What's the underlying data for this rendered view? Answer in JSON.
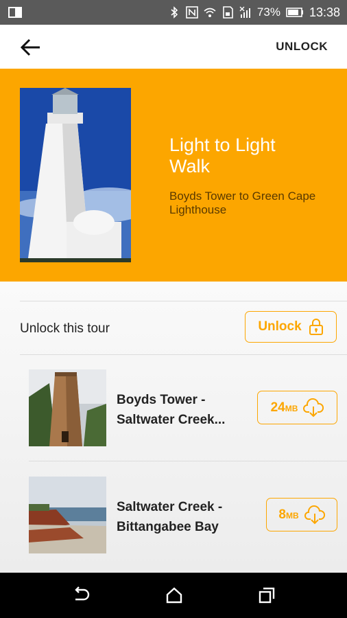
{
  "status_bar": {
    "battery": "73%",
    "time": "13:38"
  },
  "app_bar": {
    "unlock_label": "UNLOCK"
  },
  "hero": {
    "title": "Light to Light Walk",
    "subtitle": "Boyds Tower to Green Cape Lighthouse"
  },
  "unlock_row": {
    "label": "Unlock this tour",
    "button_label": "Unlock"
  },
  "tour_items": [
    {
      "title_line1": "Boyds Tower -",
      "title_line2": "Saltwater Creek...",
      "size": "24",
      "unit": "MB"
    },
    {
      "title_line1": "Saltwater Creek -",
      "title_line2": "Bittangabee Bay",
      "size": "8",
      "unit": "MB"
    }
  ],
  "colors": {
    "accent": "#fca600",
    "status_bar": "#5a5a5a",
    "nav_bar": "#000000"
  }
}
